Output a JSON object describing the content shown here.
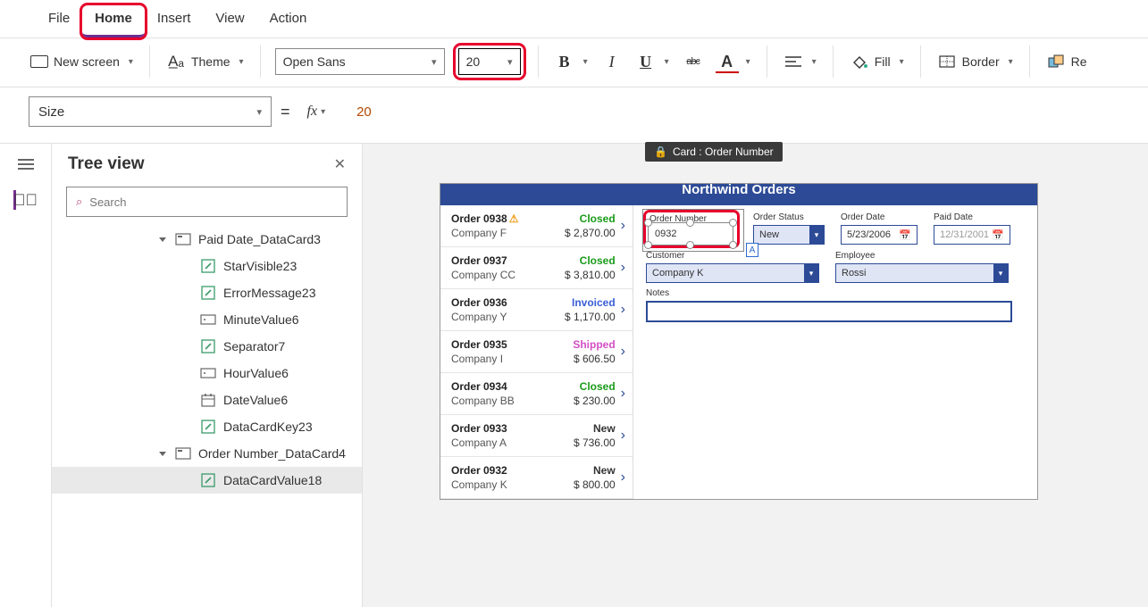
{
  "menu": {
    "file": "File",
    "home": "Home",
    "insert": "Insert",
    "view": "View",
    "action": "Action"
  },
  "ribbon": {
    "new_screen": "New screen",
    "theme": "Theme",
    "font": "Open Sans",
    "font_size": "20",
    "bold": "B",
    "italic": "I",
    "underline": "U",
    "strike": "abc",
    "font_color": "A",
    "fill": "Fill",
    "border": "Border",
    "reorder": "Re"
  },
  "formula": {
    "property": "Size",
    "fx": "fx",
    "value": "20"
  },
  "tree": {
    "title": "Tree view",
    "search_placeholder": "Search",
    "items": [
      {
        "name": "Paid Date_DataCard3",
        "icon": "card",
        "indent": 1,
        "collapsible": true
      },
      {
        "name": "StarVisible23",
        "icon": "edit",
        "indent": 2
      },
      {
        "name": "ErrorMessage23",
        "icon": "edit",
        "indent": 2
      },
      {
        "name": "MinuteValue6",
        "icon": "input",
        "indent": 2
      },
      {
        "name": "Separator7",
        "icon": "edit",
        "indent": 2
      },
      {
        "name": "HourValue6",
        "icon": "input",
        "indent": 2
      },
      {
        "name": "DateValue6",
        "icon": "date",
        "indent": 2
      },
      {
        "name": "DataCardKey23",
        "icon": "edit",
        "indent": 2
      },
      {
        "name": "Order Number_DataCard4",
        "icon": "card",
        "indent": 1,
        "collapsible": true
      },
      {
        "name": "DataCardValue18",
        "icon": "edit",
        "indent": 2,
        "selected": true
      }
    ]
  },
  "selection_badge": "Card : Order Number",
  "app_title": "Northwind Orders",
  "gallery": [
    {
      "order": "Order 0938",
      "company": "Company F",
      "status": "Closed",
      "status_class": "st-closed",
      "amount": "$ 2,870.00",
      "warn": true
    },
    {
      "order": "Order 0937",
      "company": "Company CC",
      "status": "Closed",
      "status_class": "st-closed",
      "amount": "$ 3,810.00"
    },
    {
      "order": "Order 0936",
      "company": "Company Y",
      "status": "Invoiced",
      "status_class": "st-invoiced",
      "amount": "$ 1,170.00"
    },
    {
      "order": "Order 0935",
      "company": "Company I",
      "status": "Shipped",
      "status_class": "st-shipped",
      "amount": "$ 606.50"
    },
    {
      "order": "Order 0934",
      "company": "Company BB",
      "status": "Closed",
      "status_class": "st-closed",
      "amount": "$ 230.00"
    },
    {
      "order": "Order 0933",
      "company": "Company A",
      "status": "New",
      "status_class": "st-new",
      "amount": "$ 736.00"
    },
    {
      "order": "Order 0932",
      "company": "Company K",
      "status": "New",
      "status_class": "st-new",
      "amount": "$ 800.00"
    }
  ],
  "form": {
    "order_number": {
      "label": "Order Number",
      "value": "0932"
    },
    "order_status": {
      "label": "Order Status",
      "value": "New"
    },
    "order_date": {
      "label": "Order Date",
      "value": "5/23/2006"
    },
    "paid_date": {
      "label": "Paid Date",
      "value": "12/31/2001"
    },
    "customer": {
      "label": "Customer",
      "value": "Company K"
    },
    "employee": {
      "label": "Employee",
      "value": "Rossi"
    },
    "notes": {
      "label": "Notes"
    }
  }
}
